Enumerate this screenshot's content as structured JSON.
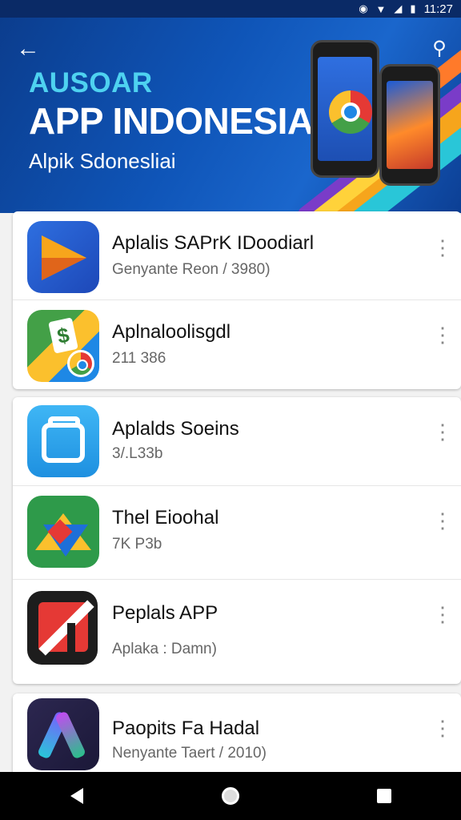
{
  "status_bar": {
    "time": "11:27",
    "icons": [
      "location-icon",
      "wifi-icon",
      "signal-icon",
      "battery-icon"
    ]
  },
  "header": {
    "kicker": "AUSOAR",
    "title": "APP INDONESIA",
    "subtitle": "Alpik Sdonesliai",
    "colors": {
      "banner": "#0f55b8",
      "kicker": "#4ed2f0",
      "stripe_orange": "#f6a51c",
      "stripe_purple": "#7a3cc8"
    }
  },
  "apps": [
    {
      "name": "Aplalis SAPrK IDoodiarl",
      "meta": "Genyante Reon / 3980)",
      "icon": "play-triangle-icon"
    },
    {
      "name": "Aplnaloolisgdl",
      "meta": "211 386",
      "icon": "maps-dollar-icon"
    },
    {
      "name": "Aplalds Soeins",
      "meta": "3/.L33b",
      "icon": "frame-window-icon"
    },
    {
      "name": "Thel Eioohal",
      "meta": "7K P3b",
      "icon": "drive-triangle-icon"
    },
    {
      "name": "Peplals APP",
      "meta": "Aplaka : Damn)",
      "icon": "red-slash-icon"
    },
    {
      "name": "Paopits Fa Hadal",
      "meta": "Nenyante Taert / 2010)",
      "icon": "purple-a-icon"
    }
  ]
}
